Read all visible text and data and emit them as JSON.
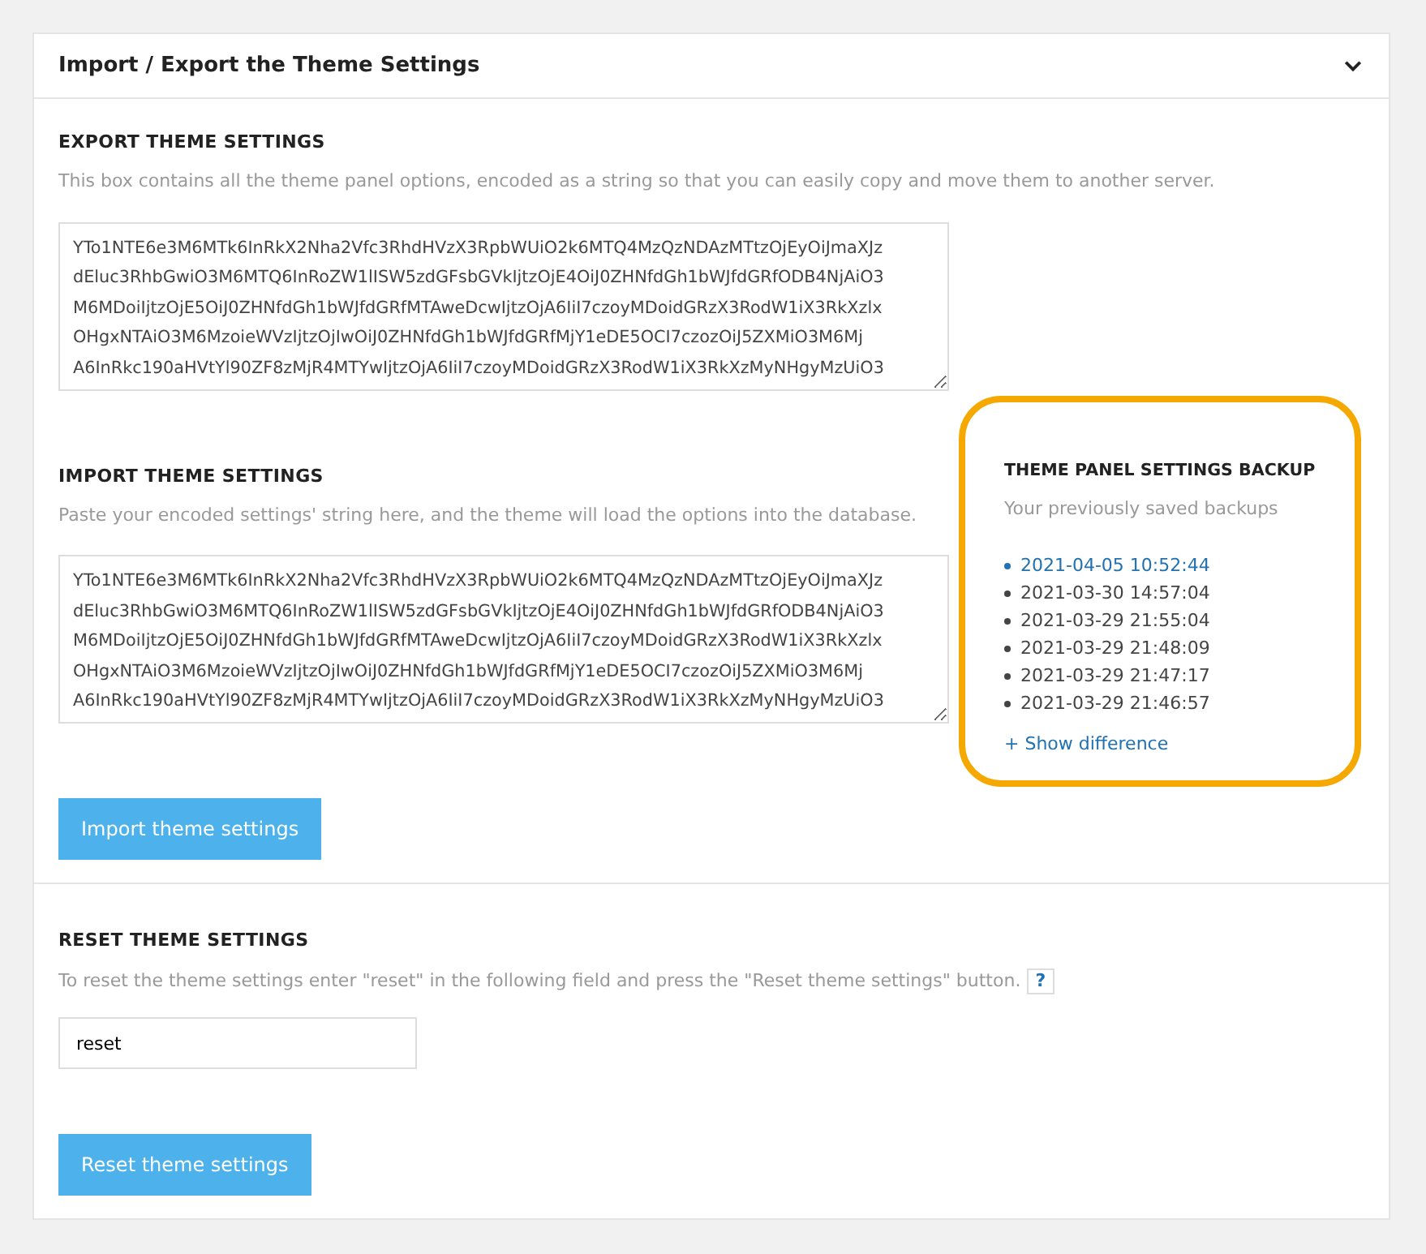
{
  "panel": {
    "title": "Import / Export the Theme Settings",
    "expanded": true
  },
  "export": {
    "heading": "EXPORT THEME SETTINGS",
    "description": "This box contains all the theme panel options, encoded as a string so that you can easily copy and move them to another server.",
    "lines": [
      "YTo1NTE6e3M6MTk6InRkX2Nha2Vfc3RhdHVzX3RpbWUiO2k6MTQ4MzQzNDAzMTtzOjEyOiJmaXJz",
      "dEluc3RhbGwiO3M6MTQ6InRoZW1lISW5zdGFsbGVkIjtzOjE4OiJ0ZHNfdGh1bWJfdGRfODB4NjAiO3",
      "M6MDoiIjtzOjE5OiJ0ZHNfdGh1bWJfdGRfMTAweDcwIjtzOjA6IiI7czoyMDoidGRzX3RodW1iX3RkXzlx",
      "OHgxNTAiO3M6MzoieWVzIjtzOjIwOiJ0ZHNfdGh1bWJfdGRfMjY1eDE5OCI7czozOiJ5ZXMiO3M6Mj",
      "A6InRkc190aHVtYl90ZF8zMjR4MTYwIjtzOjA6IiI7czoyMDoidGRzX3RodW1iX3RkXzMyNHgyMzUiO3"
    ]
  },
  "import": {
    "heading": "IMPORT THEME SETTINGS",
    "description": "Paste your encoded settings' string here, and the theme will load the options into the database.",
    "lines": [
      "YTo1NTE6e3M6MTk6InRkX2Nha2Vfc3RhdHVzX3RpbWUiO2k6MTQ4MzQzNDAzMTtzOjEyOiJmaXJz",
      "dEluc3RhbGwiO3M6MTQ6InRoZW1lISW5zdGFsbGVkIjtzOjE4OiJ0ZHNfdGh1bWJfdGRfODB4NjAiO3",
      "M6MDoiIjtzOjE5OiJ0ZHNfdGh1bWJfdGRfMTAweDcwIjtzOjA6IiI7czoyMDoidGRzX3RodW1iX3RkXzlx",
      "OHgxNTAiO3M6MzoieWVzIjtzOjIwOiJ0ZHNfdGh1bWJfdGRfMjY1eDE5OCI7czozOiJ5ZXMiO3M6Mj",
      "A6InRkc190aHVtYl90ZF8zMjR4MTYwIjtzOjA6IiI7czoyMDoidGRzX3RodW1iX3RkXzMyNHgyMzUiO3"
    ],
    "button": "Import theme settings"
  },
  "backup": {
    "heading": "THEME PANEL SETTINGS BACKUP",
    "description": "Your previously saved backups",
    "highlighted": true,
    "items": [
      {
        "label": "2021-04-05 10:52:44",
        "selected": true
      },
      {
        "label": "2021-03-30 14:57:04",
        "selected": false
      },
      {
        "label": "2021-03-29 21:55:04",
        "selected": false
      },
      {
        "label": "2021-03-29 21:48:09",
        "selected": false
      },
      {
        "label": "2021-03-29 21:47:17",
        "selected": false
      },
      {
        "label": "2021-03-29 21:46:57",
        "selected": false
      }
    ],
    "link": "+ Show difference"
  },
  "reset": {
    "heading": "RESET THEME SETTINGS",
    "description": "To reset the theme settings enter \"reset\" in the following field and press the \"Reset theme settings\" button.",
    "help": "?",
    "value": "reset",
    "button": "Reset theme settings"
  }
}
